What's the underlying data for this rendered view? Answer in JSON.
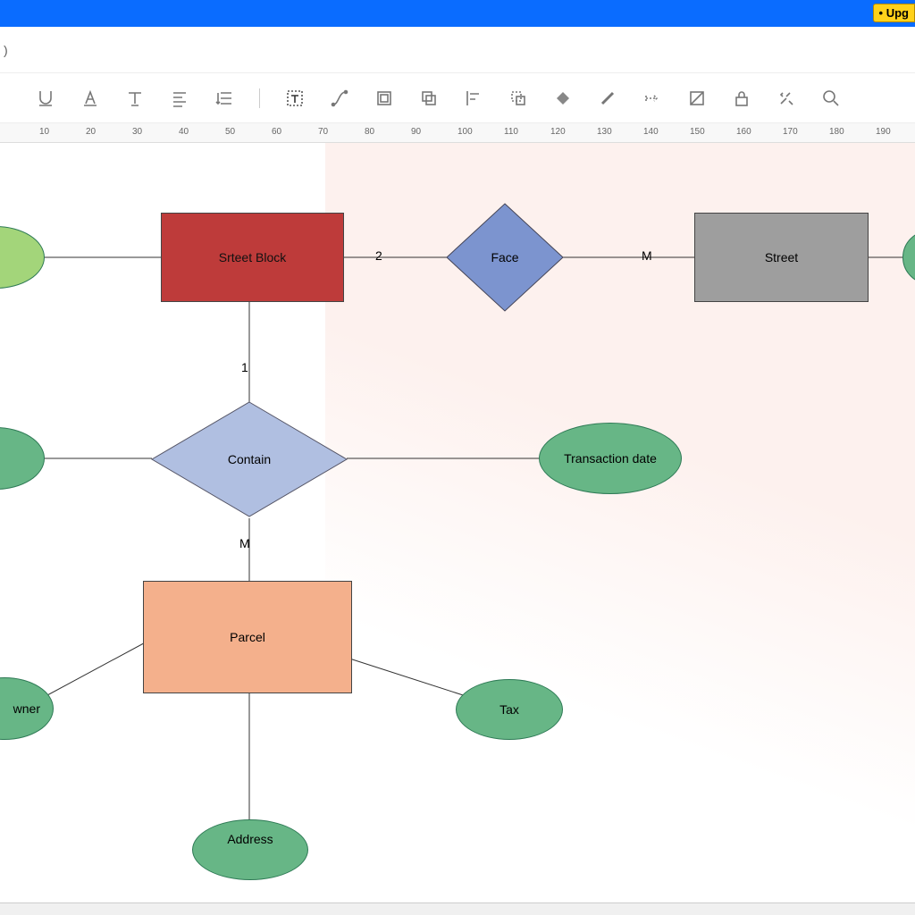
{
  "header": {
    "upgrade_label": "Upg"
  },
  "subheader": {
    "suffix": ")"
  },
  "ruler": {
    "start": 0,
    "step": 10,
    "count": 25
  },
  "diagram": {
    "entities": {
      "street_block": "Srteet Block",
      "street": "Street",
      "parcel": "Parcel"
    },
    "relationships": {
      "face": "Face",
      "contain": "Contain"
    },
    "attributes": {
      "transaction_date": "Transaction date",
      "tax": "Tax",
      "owner": "wner",
      "address": "Address"
    },
    "cardinalities": {
      "block_face": "2",
      "face_street": "M",
      "block_contain": "1",
      "contain_parcel": "M"
    },
    "colors": {
      "red": "#be3b3a",
      "grey": "#9e9e9e",
      "peach": "#f4b08c",
      "lgreen": "#a3d57a",
      "green": "#67b686",
      "blue": "#9aacd6"
    }
  }
}
